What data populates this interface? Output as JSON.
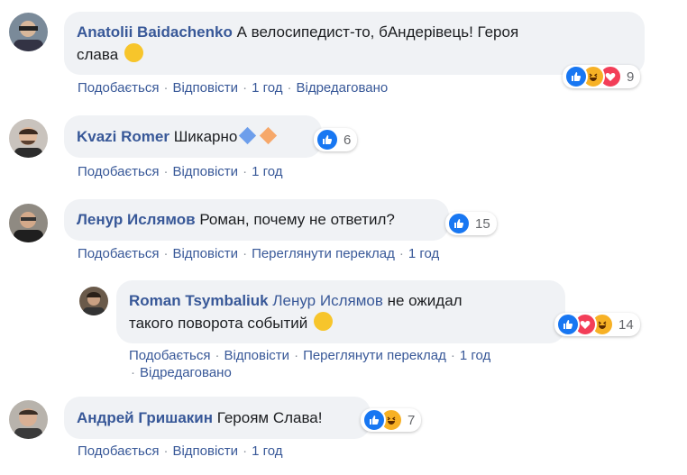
{
  "labels": {
    "like": "Подобається",
    "reply": "Відповісти",
    "translate": "Переглянути переклад",
    "edited": "Відредаговано",
    "sep": "·"
  },
  "comments": [
    {
      "author": "Anatolii Baidachenko",
      "text_line1": "А велосипедист-то, бАндерівець! Героя",
      "text_line2": "слава",
      "reactions_count": "9",
      "time": "1 год"
    },
    {
      "author": "Kvazi Romer",
      "text": "Шикарно",
      "reactions_count": "6",
      "time": "1 год"
    },
    {
      "author": "Ленур Ислямов",
      "text": "Роман, почему не ответил?",
      "reactions_count": "15",
      "time": "1 год"
    },
    {
      "author": "Roman Tsymbaliuk",
      "mention": "Ленур Ислямов",
      "text_line1": " не ожидал",
      "text_line2": "такого поворота событий",
      "reactions_count": "14",
      "time": "1 год"
    },
    {
      "author": "Андрей Гришакин",
      "text": "Героям Слава!",
      "reactions_count": "7",
      "time": "1 год"
    }
  ],
  "colors": {
    "like": "#1877f2",
    "love": "#f33e58",
    "haha": "#f7b125",
    "link": "#385898",
    "bubble": "#f0f2f5"
  }
}
